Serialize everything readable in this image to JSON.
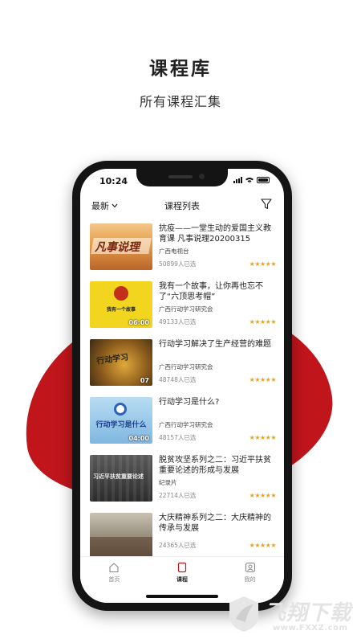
{
  "promo": {
    "title": "课程库",
    "subtitle": "所有课程汇集"
  },
  "status_bar": {
    "time": "10:24"
  },
  "header": {
    "sort_label": "最新",
    "title": "课程列表",
    "filter_icon": "filter-icon"
  },
  "courses": [
    {
      "title": "抗疫——一堂生动的爱国主义教育课 凡事说理20200315",
      "source": "广西电视台",
      "count": "50899人已选",
      "stars": "★★★★★",
      "duration": "",
      "thumb_text": "凡事说理"
    },
    {
      "title": "我有一个故事，让你再也忘不了“六顶思考帽”",
      "source": "广西行动学习研究会",
      "count": "49133人已选",
      "stars": "★★★★★",
      "duration": "06:00",
      "thumb_text": "我有一个故事"
    },
    {
      "title": "行动学习解决了生产经营的难题",
      "source": "广西行动学习研究会",
      "count": "48748人已选",
      "stars": "★★★★★",
      "duration": "07",
      "thumb_text": "行动学习"
    },
    {
      "title": "行动学习是什么?",
      "source": "广西行动学习研究会",
      "count": "48157人已选",
      "stars": "★★★★★",
      "duration": "04:00",
      "thumb_text": "行动学习是什么"
    },
    {
      "title": "脱贫攻坚系列之二：习近平扶贫重要论述的形成与发展",
      "source": "纪录片",
      "count": "22714人已选",
      "stars": "★★★★★",
      "duration": "",
      "thumb_text": "习近平扶贫重要论述"
    },
    {
      "title": "大庆精神系列之二：大庆精神的传承与发展",
      "source": "",
      "count": "24365人已选",
      "stars": "★★★★★",
      "duration": "",
      "thumb_text": ""
    }
  ],
  "tabs": [
    {
      "label": "首页",
      "icon": "home-icon",
      "active": false
    },
    {
      "label": "课程",
      "icon": "course-icon",
      "active": true
    },
    {
      "label": "我的",
      "icon": "profile-icon",
      "active": false
    }
  ],
  "watermark": {
    "name": "飞翔下载",
    "url": "www.FXXZ.com"
  },
  "colors": {
    "accent_red": "#c1151c",
    "star_gold": "#e8a317"
  }
}
